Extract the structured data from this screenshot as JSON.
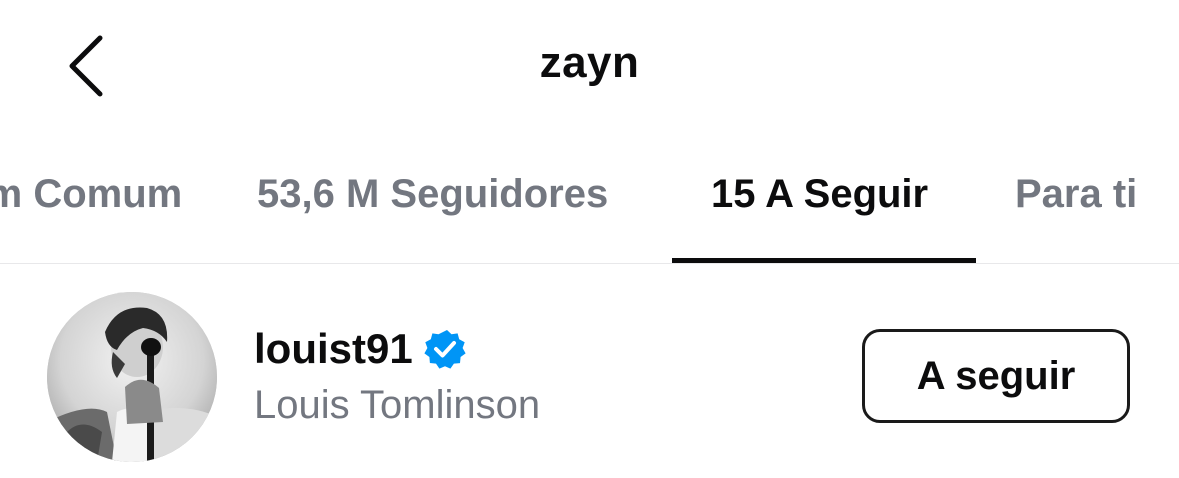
{
  "header": {
    "title": "zayn",
    "back_icon": "chevron-left-icon"
  },
  "tabs": [
    {
      "label": "Em Comum"
    },
    {
      "label": "53,6 M Seguidores"
    },
    {
      "label": "15 A Seguir",
      "active": true
    },
    {
      "label": "Para ti"
    }
  ],
  "list": {
    "items": [
      {
        "username": "louist91",
        "verified": true,
        "full_name": "Louis Tomlinson",
        "button_label": "A seguir"
      }
    ]
  },
  "colors": {
    "text_primary": "#0c0c0d",
    "text_secondary": "#737780",
    "verified_blue": "#0095f6",
    "divider": "#e8e8ea"
  }
}
